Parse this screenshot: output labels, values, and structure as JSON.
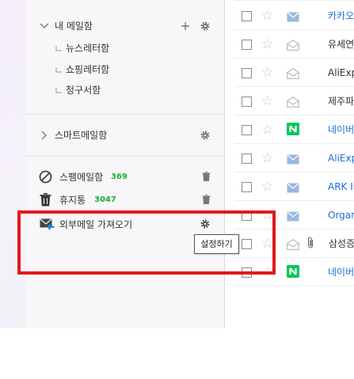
{
  "sidebar": {
    "my_mailbox": {
      "label": "내 메일함",
      "folders": [
        "뉴스레터함",
        "쇼핑레터함",
        "청구서함"
      ]
    },
    "smart_mailbox": {
      "label": "스마트메일함"
    },
    "spam": {
      "label": "스팸메일함",
      "count": "369"
    },
    "trash": {
      "label": "휴지통",
      "count": "3047"
    },
    "external": {
      "label": "외부메일 가져오기"
    }
  },
  "tooltip": {
    "text": "설정하기"
  },
  "mail_list": [
    {
      "sender": "카카오",
      "icon": "envelope-closed-icon",
      "color": "blue"
    },
    {
      "sender": "유세연",
      "icon": "envelope-open-icon",
      "color": "dark"
    },
    {
      "sender": "AliExp",
      "icon": "envelope-open-icon",
      "color": "dark"
    },
    {
      "sender": "제주파",
      "icon": "envelope-open-icon",
      "color": "dark"
    },
    {
      "sender": "네이버",
      "icon": "naver-icon",
      "color": "blue"
    },
    {
      "sender": "AliExp",
      "icon": "envelope-closed-icon",
      "color": "blue"
    },
    {
      "sender": "ARK In",
      "icon": "envelope-closed-icon",
      "color": "blue"
    },
    {
      "sender": "Organ",
      "icon": "envelope-closed-icon",
      "color": "blue"
    },
    {
      "sender": "삼성증",
      "icon": "envelope-open-icon",
      "color": "dark",
      "attachment": true
    },
    {
      "sender": "네이버",
      "icon": "naver-icon",
      "color": "blue"
    }
  ],
  "colors": {
    "accent_blue": "#1d6fd6",
    "naver_green": "#03c75a",
    "count_green": "#19b033",
    "highlight_red": "#e0181c"
  }
}
